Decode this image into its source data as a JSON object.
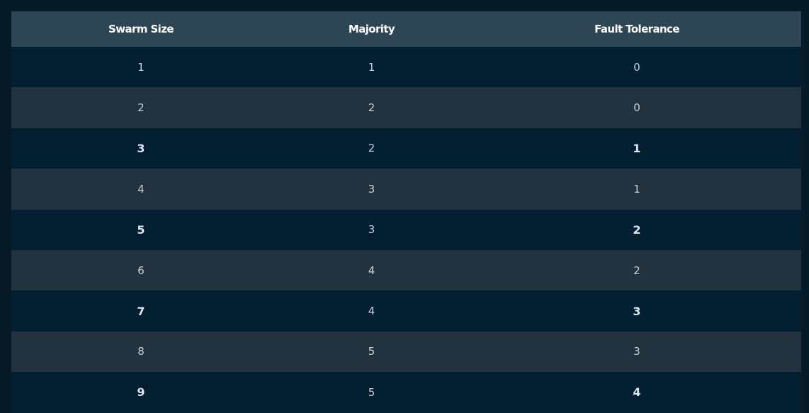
{
  "table": {
    "headers": [
      "Swarm Size",
      "Majority",
      "Fault Tolerance"
    ],
    "rows": [
      {
        "swarm_size": "1",
        "majority": "1",
        "fault_tolerance": "0"
      },
      {
        "swarm_size": "2",
        "majority": "2",
        "fault_tolerance": "0"
      },
      {
        "swarm_size": "3",
        "majority": "2",
        "fault_tolerance": "1"
      },
      {
        "swarm_size": "4",
        "majority": "3",
        "fault_tolerance": "1"
      },
      {
        "swarm_size": "5",
        "majority": "3",
        "fault_tolerance": "2"
      },
      {
        "swarm_size": "6",
        "majority": "4",
        "fault_tolerance": "2"
      },
      {
        "swarm_size": "7",
        "majority": "4",
        "fault_tolerance": "3"
      },
      {
        "swarm_size": "8",
        "majority": "5",
        "fault_tolerance": "3"
      },
      {
        "swarm_size": "9",
        "majority": "5",
        "fault_tolerance": "4"
      }
    ]
  },
  "colors": {
    "page_background": "#061a28",
    "header_background": "#2d4554",
    "row_dark": "#021e31",
    "row_light": "#22333f",
    "header_text": "#ffffff",
    "cell_text": "#c6d0d8"
  }
}
